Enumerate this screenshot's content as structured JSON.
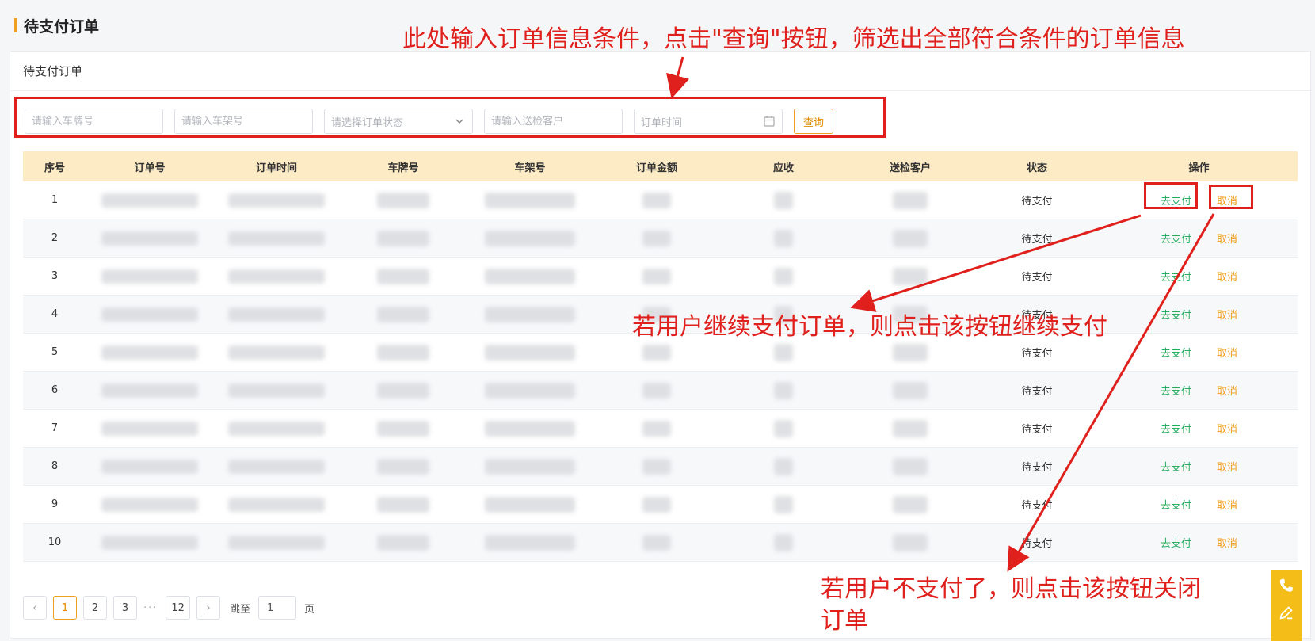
{
  "page": {
    "title": "待支付订单"
  },
  "card": {
    "title": "待支付订单"
  },
  "filters": {
    "plate_placeholder": "请输入车牌号",
    "vin_placeholder": "请输入车架号",
    "status_placeholder": "请选择订单状态",
    "customer_placeholder": "请输入送检客户",
    "date_placeholder": "订单时间",
    "query_label": "查询"
  },
  "table": {
    "columns": [
      "序号",
      "订单号",
      "订单时间",
      "车牌号",
      "车架号",
      "订单金额",
      "应收",
      "送检客户",
      "状态",
      "操作"
    ],
    "rows": [
      {
        "index": "1",
        "status": "待支付",
        "pay": "去支付",
        "cancel": "取消"
      },
      {
        "index": "2",
        "status": "待支付",
        "pay": "去支付",
        "cancel": "取消"
      },
      {
        "index": "3",
        "status": "待支付",
        "pay": "去支付",
        "cancel": "取消"
      },
      {
        "index": "4",
        "status": "待支付",
        "pay": "去支付",
        "cancel": "取消"
      },
      {
        "index": "5",
        "status": "待支付",
        "pay": "去支付",
        "cancel": "取消"
      },
      {
        "index": "6",
        "status": "待支付",
        "pay": "去支付",
        "cancel": "取消"
      },
      {
        "index": "7",
        "status": "待支付",
        "pay": "去支付",
        "cancel": "取消"
      },
      {
        "index": "8",
        "status": "待支付",
        "pay": "去支付",
        "cancel": "取消"
      },
      {
        "index": "9",
        "status": "待支付",
        "pay": "去支付",
        "cancel": "取消"
      },
      {
        "index": "10",
        "status": "待支付",
        "pay": "去支付",
        "cancel": "取消"
      }
    ]
  },
  "pagination": {
    "prev": "‹",
    "pages": [
      "1",
      "2",
      "3"
    ],
    "ellipsis": "···",
    "last": "12",
    "next": "›",
    "jump_prefix": "跳至",
    "jump_value": "1",
    "jump_suffix": "页"
  },
  "annotations": {
    "top": "此处输入订单信息条件，点击\"查询\"按钮，筛选出全部符合条件的订单信息",
    "pay": "若用户继续支付订单，则点击该按钮继续支付",
    "cancel_line1": "若用户不支付了，则点击该按钮关闭",
    "cancel_line2": "订单"
  },
  "colors": {
    "accent": "#f0a020",
    "header_bg": "#fdebc6",
    "pay": "#27ae60",
    "annotation": "#e0201c"
  },
  "icons": [
    "calendar-icon",
    "chevron-down-icon",
    "phone-icon",
    "edit-icon"
  ]
}
